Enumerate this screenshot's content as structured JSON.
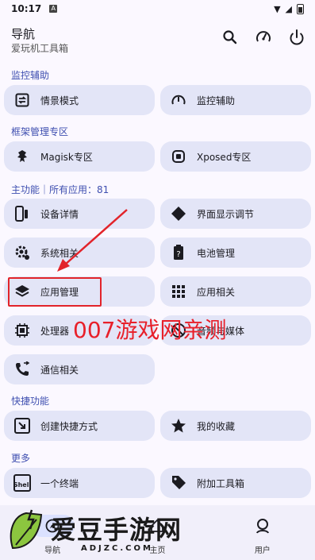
{
  "status": {
    "time": "10:17",
    "notif_glyph": "A"
  },
  "appbar": {
    "title": "导航",
    "subtitle": "爱玩机工具箱",
    "icons": [
      "search-icon",
      "speedometer-icon",
      "power-icon"
    ]
  },
  "sections": {
    "monitor": "监控辅助",
    "framework": "框架管理专区",
    "main": "主功能｜所有应用：81",
    "shortcut": "快捷功能",
    "more": "更多"
  },
  "cards": {
    "scene_mode": "情景模式",
    "monitor_assist": "监控辅助",
    "magisk": "Magisk专区",
    "xposed": "Xposed专区",
    "device_info": "设备详情",
    "display_adjust": "界面显示调节",
    "system": "系统相关",
    "battery": "电池管理",
    "app_manage": "应用管理",
    "app_related": "应用相关",
    "processor": "处理器",
    "audio_media": "音频与媒体",
    "telecom": "通信相关",
    "create_shortcut": "创建快捷方式",
    "favorites": "我的收藏",
    "terminal": "一个终端",
    "extra_tools": "附加工具箱"
  },
  "overlay": {
    "watermark_text": "007游戏网亲测",
    "logo_text": "爱豆手游网",
    "logo_url": "ADJZC.COM"
  },
  "nav": {
    "items": [
      {
        "label": "导航",
        "icon": "compass-icon"
      },
      {
        "label": "主页",
        "icon": "home-icon"
      },
      {
        "label": "用户",
        "icon": "user-icon"
      }
    ]
  },
  "colors": {
    "accent": "#3f4fb0",
    "card": "#e3e5f7",
    "highlight": "#e2232a"
  }
}
